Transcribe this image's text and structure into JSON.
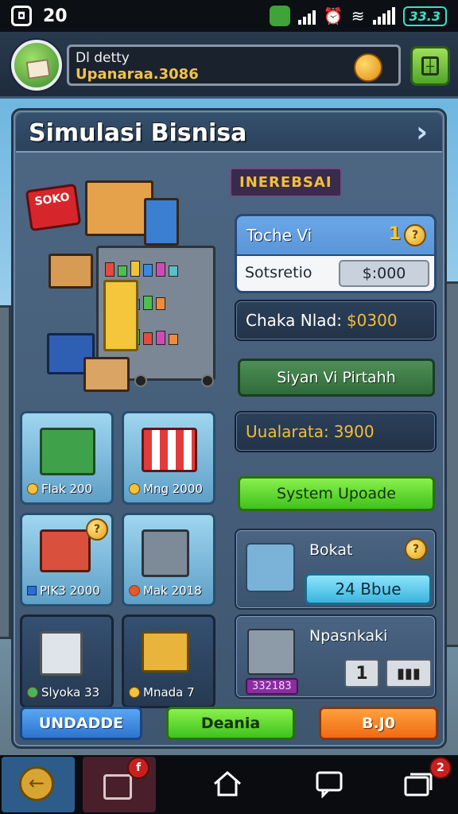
{
  "statusbar": {
    "time": "20",
    "battery": "33.3"
  },
  "profile": {
    "name": "Dl detty",
    "subtitle": "Upanaraa.3086"
  },
  "panel": {
    "title": "Simulasi Bisnisa",
    "interest_badge": "INEREBSAI"
  },
  "touche_card": {
    "label": "Toche Vi",
    "count": "1",
    "coin": "?",
    "row_label": "Sotsretio",
    "row_value": "$:000"
  },
  "stats": {
    "chaka_label": "Chaka Nlad:",
    "chaka_value": "$0300",
    "uala_label": "Uualarata:",
    "uala_value": "3900"
  },
  "buttons": {
    "siyan": "Siyan Vi Pirtahh",
    "system_upgrade": "System Upoade",
    "bottom_blue": "UNDADDE",
    "bottom_green": "Deania",
    "bottom_orange": "B.J0"
  },
  "tiles": [
    {
      "label": "Flak 200",
      "theme": "light",
      "icon": "coin"
    },
    {
      "label": "Mng 2000",
      "theme": "light",
      "icon": "coin"
    },
    {
      "label": "PIK3 2000",
      "theme": "light",
      "icon": "square"
    },
    {
      "label": "Mak 2018",
      "theme": "dark",
      "icon": "coin"
    },
    {
      "label": "Slyoka 33",
      "theme": "dark",
      "icon": "coin"
    },
    {
      "label": "Mnada 7",
      "theme": "dark",
      "icon": "coin"
    }
  ],
  "bokat_card": {
    "title": "Bokat",
    "coin": "?",
    "button": "24 Bbue"
  },
  "npasm_card": {
    "title": "Npasnkaki",
    "count": "1",
    "chip": "332183"
  },
  "navbar": {
    "badge_left": "f",
    "badge_right": "2"
  },
  "colors": {
    "accent_gold": "#f4bd39",
    "btn_green": "#3fc21d",
    "btn_blue": "#2f74cf",
    "btn_orange": "#f06a14",
    "panel": "#4d6784"
  }
}
